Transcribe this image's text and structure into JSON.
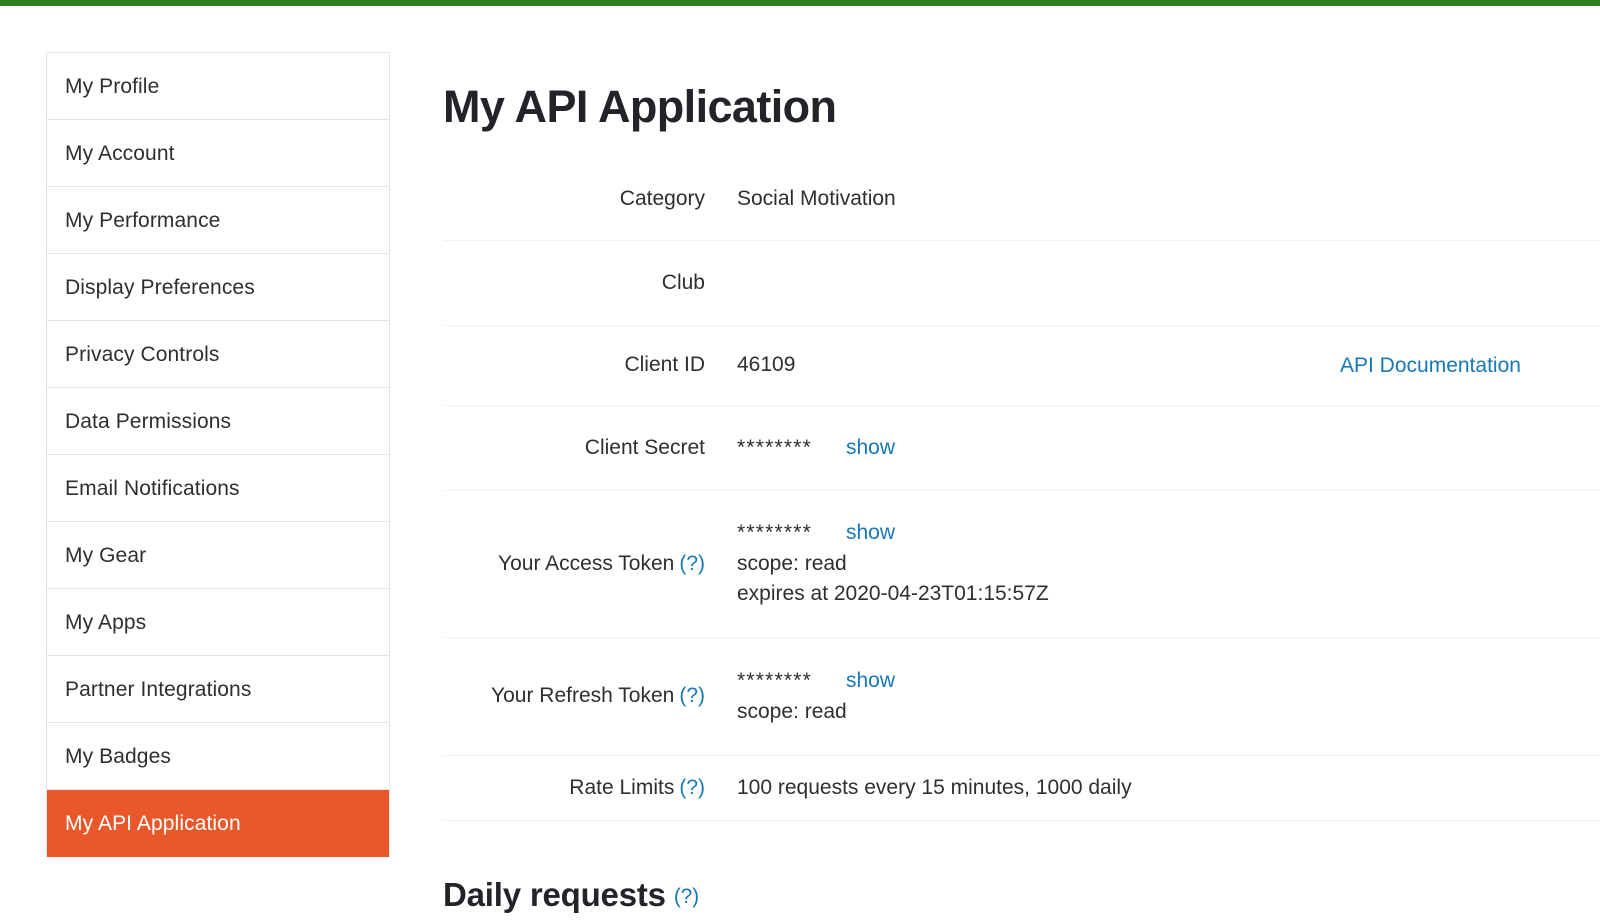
{
  "brand": {
    "accent_green": "#2e7d1e",
    "accent_orange": "#e8582a",
    "link_blue": "#1878b5"
  },
  "sidebar": {
    "items": [
      {
        "label": "My Profile",
        "active": false
      },
      {
        "label": "My Account",
        "active": false
      },
      {
        "label": "My Performance",
        "active": false
      },
      {
        "label": "Display Preferences",
        "active": false
      },
      {
        "label": "Privacy Controls",
        "active": false
      },
      {
        "label": "Data Permissions",
        "active": false
      },
      {
        "label": "Email Notifications",
        "active": false
      },
      {
        "label": "My Gear",
        "active": false
      },
      {
        "label": "My Apps",
        "active": false
      },
      {
        "label": "Partner Integrations",
        "active": false
      },
      {
        "label": "My Badges",
        "active": false
      },
      {
        "label": "My API Application",
        "active": true
      }
    ]
  },
  "main": {
    "title": "My API Application",
    "api_documentation_link": "API Documentation",
    "help_marker": "(?)",
    "show_label": "show",
    "masked_value": "********",
    "rows": {
      "category": {
        "label": "Category",
        "value": "Social Motivation"
      },
      "club": {
        "label": "Club",
        "value": ""
      },
      "client_id": {
        "label": "Client ID",
        "value": "46109"
      },
      "client_secret": {
        "label": "Client Secret",
        "value": "********"
      },
      "access_token": {
        "label": "Your Access Token",
        "value": "********",
        "scope": "scope: read",
        "expires": "expires at 2020-04-23T01:15:57Z"
      },
      "refresh_token": {
        "label": "Your Refresh Token",
        "value": "********",
        "scope": "scope: read"
      },
      "rate_limits": {
        "label": "Rate Limits",
        "value": "100 requests every 15 minutes, 1000 daily"
      }
    },
    "daily_requests_heading": "Daily requests"
  }
}
